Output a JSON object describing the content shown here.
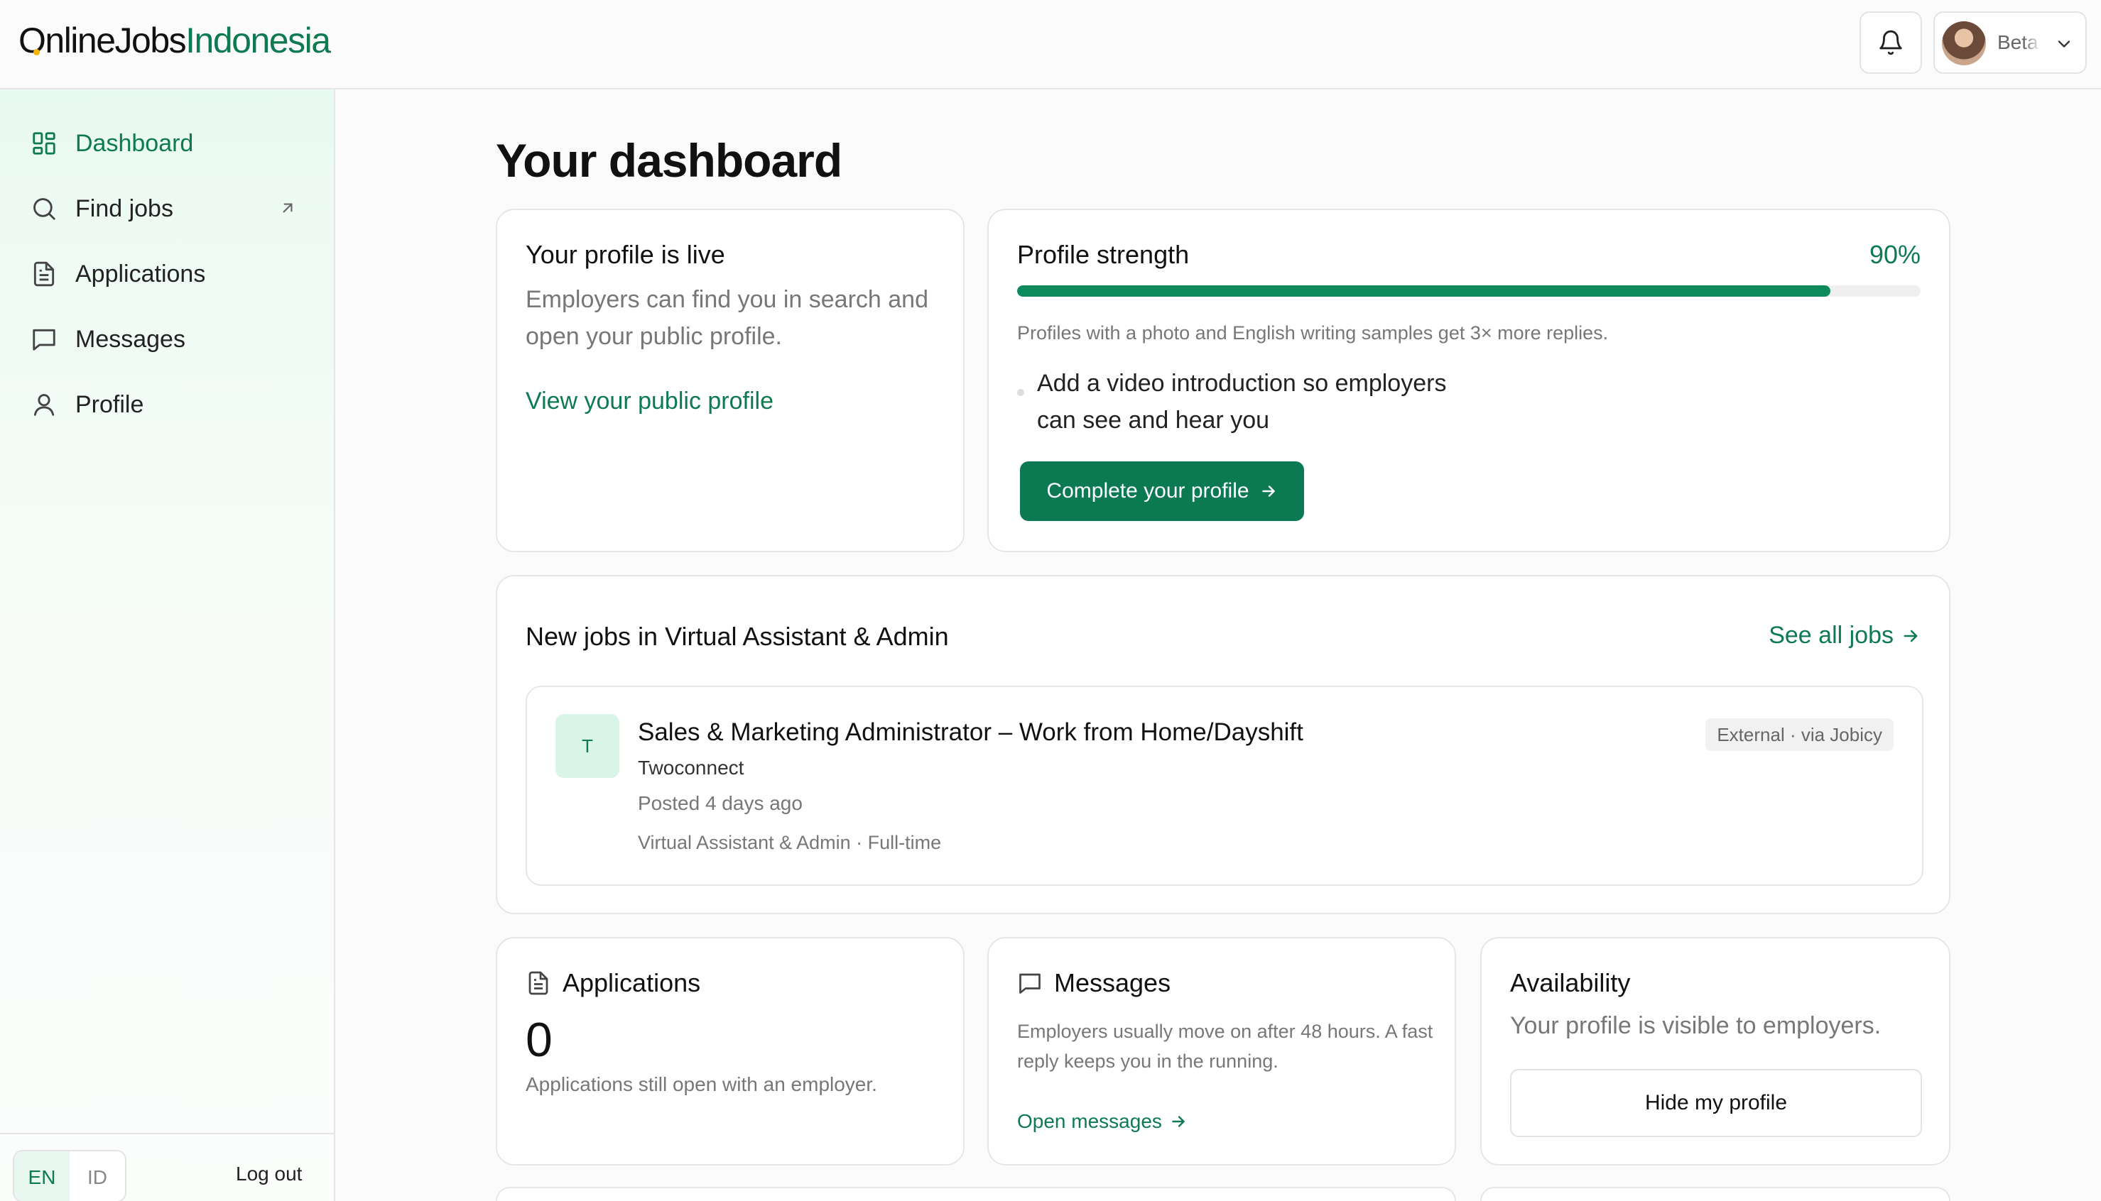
{
  "brand": {
    "name_part1": "OnlineJobs",
    "name_part2": "Indonesia"
  },
  "header": {
    "user_name": "Beta"
  },
  "sidebar": {
    "items": [
      {
        "label": "Dashboard",
        "icon": "grid-icon",
        "active": true
      },
      {
        "label": "Find jobs",
        "icon": "search-icon",
        "external": true
      },
      {
        "label": "Applications",
        "icon": "document-icon"
      },
      {
        "label": "Messages",
        "icon": "message-icon"
      },
      {
        "label": "Profile",
        "icon": "user-icon"
      }
    ],
    "languages": [
      "EN",
      "ID"
    ],
    "active_language": "EN",
    "logout_label": "Log out"
  },
  "main": {
    "title": "Your dashboard",
    "profile_live": {
      "title": "Your profile is live",
      "description": "Employers can find you in search and open your public profile.",
      "link": "View your public profile"
    },
    "profile_strength": {
      "title": "Profile strength",
      "percent_label": "90%",
      "percent": 90,
      "hint": "Profiles with a photo and English writing samples get 3× more replies.",
      "tip": "Add a video introduction so employers can see and hear you",
      "cta": "Complete your profile"
    },
    "new_jobs": {
      "title": "New jobs in Virtual Assistant & Admin",
      "see_all": "See all jobs",
      "jobs": [
        {
          "initial": "T",
          "title": "Sales & Marketing Administrator – Work from Home/Dayshift",
          "company": "Twoconnect",
          "posted": "Posted 4 days ago",
          "meta": "Virtual Assistant & Admin · Full-time",
          "badge": "External · via Jobicy"
        }
      ]
    },
    "applications": {
      "title": "Applications",
      "count": "0",
      "description": "Applications still open with an employer."
    },
    "messages": {
      "title": "Messages",
      "description": "Employers usually move on after 48 hours. A fast reply keeps you in the running.",
      "link": "Open messages"
    },
    "availability": {
      "title": "Availability",
      "description": "Your profile is visible to employers.",
      "button": "Hide my profile"
    }
  },
  "colors": {
    "accent": "#0d7a52",
    "accent_button": "#0b7a53",
    "sidebar_bg": "#e9faf1"
  }
}
